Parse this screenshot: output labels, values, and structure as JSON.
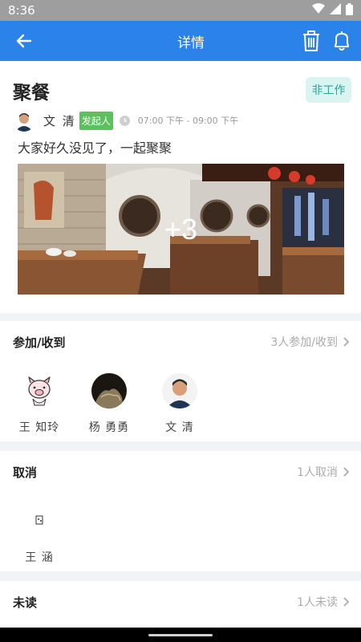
{
  "status": {
    "time": "8:36"
  },
  "appbar": {
    "title": "详情"
  },
  "event": {
    "title": "聚餐",
    "tag": "非工作",
    "organizer": "文 清",
    "organizer_badge": "发起人",
    "time_range": "07:00 下午 - 09:00 下午",
    "description": "大家好久没见了，一起聚聚",
    "more_photos": "+3"
  },
  "participants": {
    "title": "参加/收到",
    "count": "3人参加/收到",
    "people": [
      {
        "name": "王 知玲"
      },
      {
        "name": "杨 勇勇"
      },
      {
        "name": "文 清"
      }
    ]
  },
  "cancelled": {
    "title": "取消",
    "count": "1人取消",
    "people": [
      {
        "name": "王 涵"
      }
    ]
  },
  "unread": {
    "title": "未读",
    "count": "1人未读"
  },
  "colors": {
    "primary": "#2b82e8",
    "tag_bg": "#d9f4f1",
    "tag_text": "#23a89a",
    "badge": "#5cc05c"
  }
}
